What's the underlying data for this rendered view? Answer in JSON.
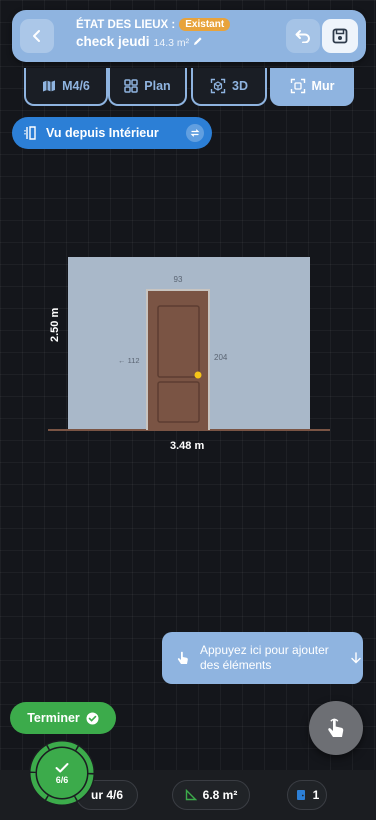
{
  "header": {
    "label": "ÉTAT DES LIEUX :",
    "status_badge": "Existant",
    "project_name": "check jeudi",
    "area": "14.3 m²"
  },
  "tabs": [
    {
      "label": "M4/6",
      "icon": "map-icon",
      "active": false
    },
    {
      "label": "Plan",
      "icon": "grid-icon",
      "active": false
    },
    {
      "label": "3D",
      "icon": "cube-icon",
      "active": false
    },
    {
      "label": "Mur",
      "icon": "wall-scan-icon",
      "active": true
    }
  ],
  "view_toggle": {
    "label": "Vu depuis Intérieur"
  },
  "wall": {
    "height_label": "2.50 m",
    "width_label": "3.48 m",
    "door_width_label": "93",
    "door_height_label": "204",
    "door_offset_label": "← 112"
  },
  "hint": {
    "text": "Appuyez ici pour ajouter des éléments"
  },
  "terminer_button": {
    "label": "Terminer"
  },
  "progress": {
    "label": "6/6"
  },
  "bottom_bar": {
    "wall_chip": "ur 4/6",
    "area_chip": "6.8 m²",
    "door_count_chip": "1"
  },
  "colors": {
    "accent_blue": "#8fb4e0",
    "primary_blue": "#2c7fd6",
    "success_green": "#3cab4b",
    "badge_orange": "#e8a33c",
    "wall_fill": "#a9b8c9",
    "door_brown": "#7a5444"
  }
}
